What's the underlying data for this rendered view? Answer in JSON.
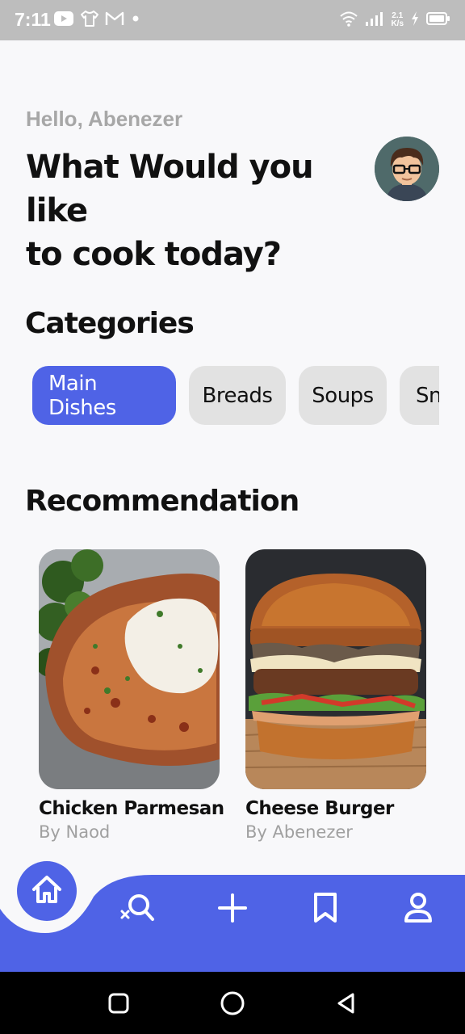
{
  "status_bar": {
    "time": "7:11",
    "net_speed_value": "2.1",
    "net_speed_unit": "K/s",
    "icons": [
      "youtube-icon",
      "shirt-icon",
      "gmail-icon",
      "dot-icon",
      "wifi-icon",
      "signal-icon",
      "charging-icon",
      "battery-icon"
    ]
  },
  "header": {
    "greeting": "Hello, Abenezer",
    "headline": "What Would you like\n to cook today?",
    "avatar_icon": "avatar-icon"
  },
  "categories": {
    "title": "Categories",
    "items": [
      {
        "label": "Main Dishes",
        "selected": true
      },
      {
        "label": "Breads",
        "selected": false
      },
      {
        "label": "Soups",
        "selected": false
      },
      {
        "label": "Snacks",
        "selected": false
      }
    ]
  },
  "recommendation": {
    "title": "Recommendation",
    "items": [
      {
        "title": "Chicken Parmesan",
        "author": "By Naod"
      },
      {
        "title": "Cheese Burger",
        "author": "By Abenezer"
      }
    ]
  },
  "bottom_nav": {
    "items": [
      "home-icon",
      "search-icon",
      "add-icon",
      "bookmark-icon",
      "profile-icon"
    ],
    "accent_color": "#4f63e6"
  },
  "system_nav": {
    "items": [
      "recents-icon",
      "home-circle-icon",
      "back-icon"
    ]
  },
  "colors": {
    "accent": "#4f63e6",
    "chip_inactive": "#e2e2e2",
    "background": "#f8f8fa",
    "muted_text": "#a0a0a0"
  }
}
